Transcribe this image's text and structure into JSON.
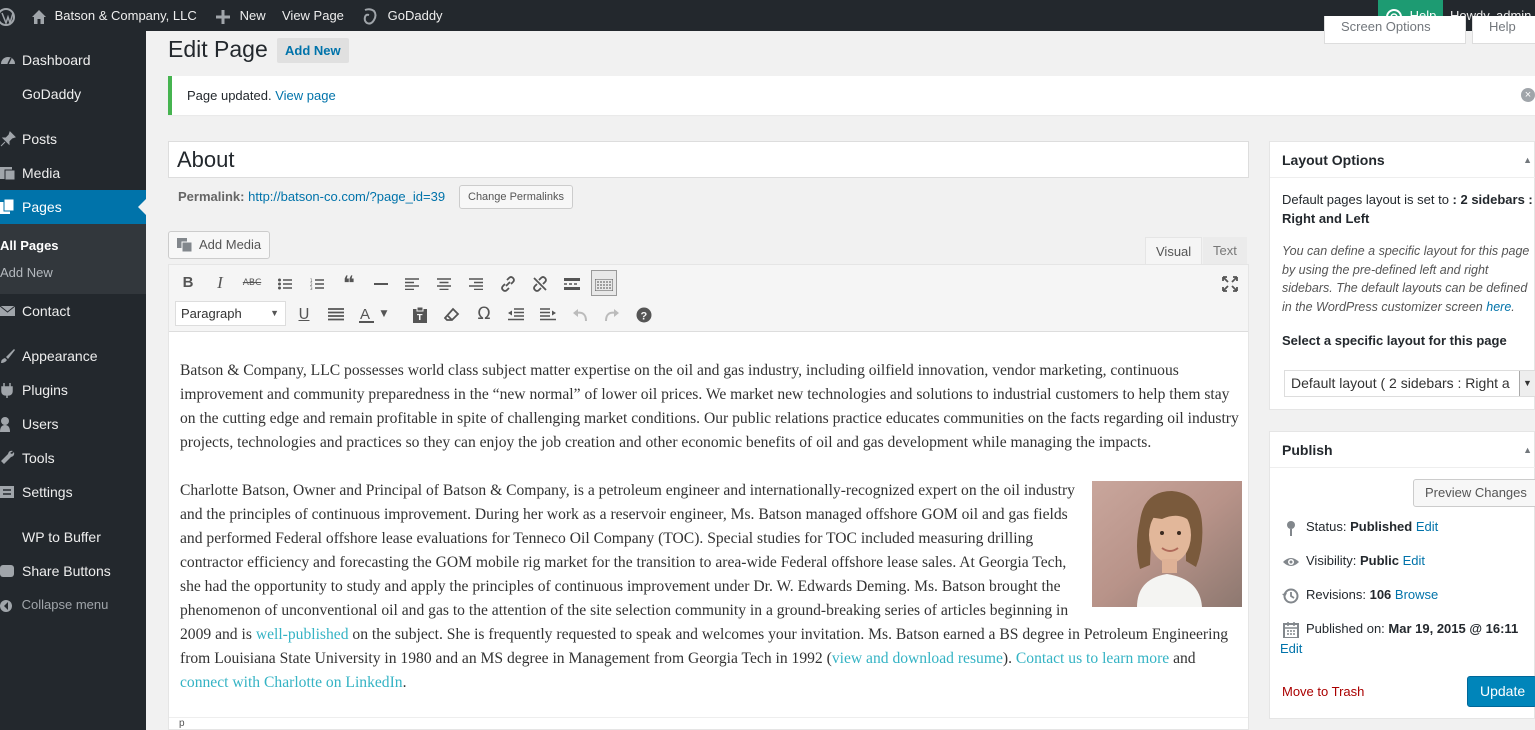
{
  "adminbar": {
    "site_name": "Batson & Company, LLC",
    "new_label": "New",
    "view_page_label": "View Page",
    "godaddy_label": "GoDaddy",
    "help_label": "Help",
    "howdy_label": "Howdy, admin"
  },
  "sidebar": {
    "items": [
      {
        "label": "Dashboard",
        "icon": "dashboard-icon"
      },
      {
        "label": "GoDaddy",
        "icon": "godaddy-icon"
      },
      {
        "label": "Posts",
        "icon": "pin-icon"
      },
      {
        "label": "Media",
        "icon": "media-icon"
      },
      {
        "label": "Pages",
        "icon": "pages-icon",
        "current": true
      },
      {
        "label": "Contact",
        "icon": "mail-icon"
      },
      {
        "label": "Appearance",
        "icon": "brush-icon"
      },
      {
        "label": "Plugins",
        "icon": "plug-icon"
      },
      {
        "label": "Users",
        "icon": "user-icon"
      },
      {
        "label": "Tools",
        "icon": "wrench-icon"
      },
      {
        "label": "Settings",
        "icon": "settings-icon"
      },
      {
        "label": "WP to Buffer",
        "icon": "buffer-icon"
      },
      {
        "label": "Share Buttons",
        "icon": "share-icon"
      }
    ],
    "submenu": [
      "All Pages",
      "Add New"
    ],
    "collapse_label": "Collapse menu"
  },
  "header": {
    "title": "Edit Page",
    "add_new": "Add New",
    "screen_options": "Screen Options",
    "help_tab": "Help"
  },
  "notice": {
    "text": "Page updated.",
    "link": "View page"
  },
  "post": {
    "title": "About",
    "permalink_label": "Permalink:",
    "permalink_url": "http://batson-co.com/?page_id=39",
    "change_permalinks": "Change Permalinks"
  },
  "editor": {
    "add_media": "Add Media",
    "tab_visual": "Visual",
    "tab_text": "Text",
    "format": "Paragraph",
    "footer_path": "p",
    "para1": "Batson & Company, LLC possesses world class subject matter expertise on the oil and gas industry, including oilfield innovation, vendor marketing, continuous improvement and community preparedness in the “new normal” of lower oil prices. We market new technologies and solutions to industrial customers to help them stay on the cutting edge and remain profitable in spite of challenging market conditions.  Our public relations practice educates communities on the facts regarding oil industry projects, technologies and practices so they can enjoy the job creation and other economic benefits of oil and gas development while managing the impacts.",
    "para2a": "Charlotte Batson, Owner and Principal of Batson & Company, is a petroleum engineer and internationally-recognized expert on the oil industry and the principles of continuous improvement. During her work as a reservoir engineer, Ms. Batson managed offshore GOM oil and gas fields and performed Federal offshore lease evaluations for Tenneco Oil Company (TOC). Special studies for TOC included measuring drilling contractor efficiency and forecasting the GOM mobile rig market for the transition to area-wide Federal offshore lease sales. At Georgia Tech, she had the opportunity to study and apply the principles of continuous improvement under Dr. W. Edwards Deming. Ms. Batson brought the phenomenon of unconventional oil and gas to the attention of the site selection community in a ground-breaking series of articles beginning in 2009 and is ",
    "link_published": "well-published",
    "para2b": " on the subject. She is frequently requested to speak and welcomes your invitation. Ms. Batson earned a BS degree in Petroleum Engineering from Louisiana State University in 1980 and an MS degree in Management from Georgia Tech in 1992 (",
    "link_resume": "view and download resume",
    "para2c": "). ",
    "link_contact": "Contact us to learn more",
    "para2d": " and ",
    "link_linkedin": "connect with Charlotte on LinkedIn",
    "para2e": "."
  },
  "layout_options": {
    "title": "Layout Options",
    "default_prefix": "Default pages layout is set to ",
    "default_value": ": 2 sidebars : Right and Left",
    "description": "You can define a specific layout for this page by using the pre-defined left and right sidebars. The default layouts can be defined in the WordPress customizer screen ",
    "here_link": "here",
    "description_end": ".",
    "select_label": "Select a specific layout for this page",
    "select_value": "Default layout ( 2 sidebars : Right a"
  },
  "publish": {
    "title": "Publish",
    "preview": "Preview Changes",
    "status_label": "Status:",
    "status_value": "Published",
    "visibility_label": "Visibility:",
    "visibility_value": "Public",
    "revisions_label": "Revisions:",
    "revisions_value": "106",
    "browse_link": "Browse",
    "published_on_label": "Published on:",
    "published_on_value": "Mar 19, 2015 @ 16:11",
    "edit_link": "Edit",
    "trash": "Move to Trash",
    "update": "Update"
  },
  "colors": {
    "adminbar_bg": "#23282d",
    "accent": "#0073aa",
    "help_green": "#1d9b72",
    "notice_green": "#46b450",
    "content_link": "#34b3c4",
    "trash_red": "#a00"
  }
}
